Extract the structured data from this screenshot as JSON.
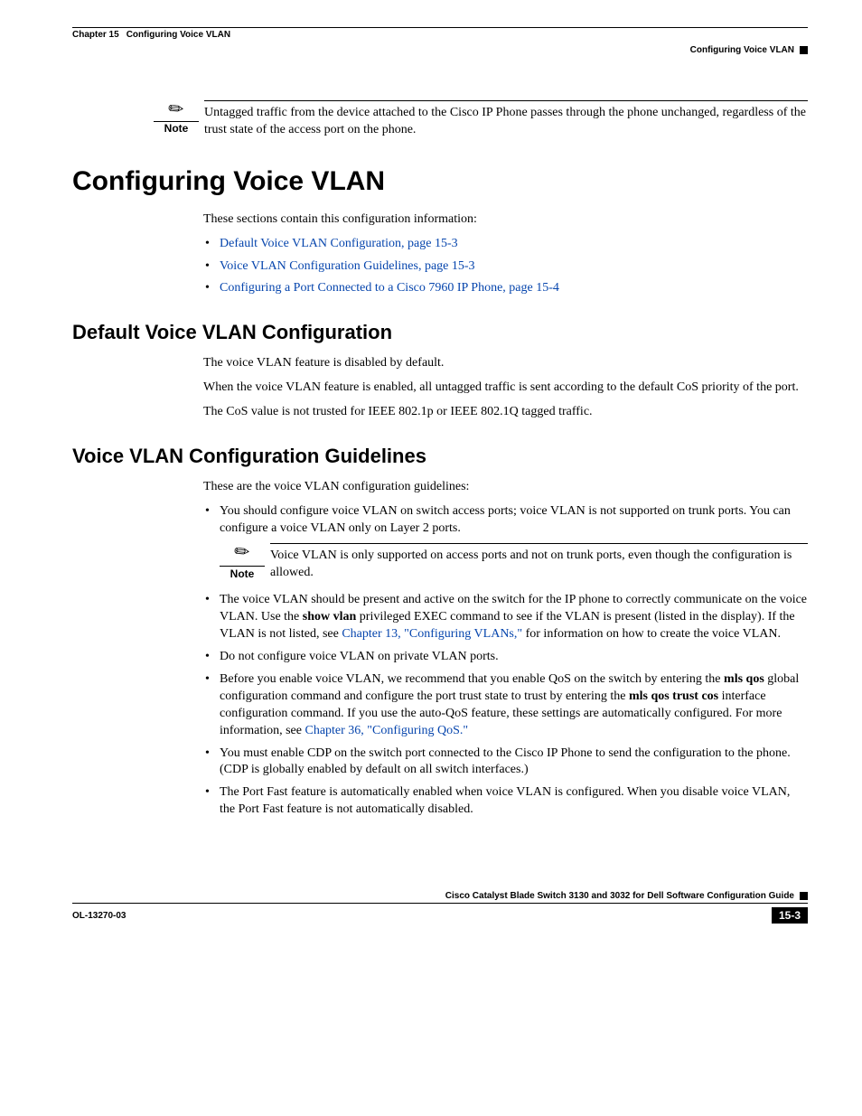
{
  "header": {
    "chapter_label": "Chapter 15",
    "chapter_title": "Configuring Voice VLAN",
    "section_right": "Configuring Voice VLAN"
  },
  "note1": {
    "label": "Note",
    "text": "Untagged traffic from the device attached to the Cisco IP Phone passes through the phone unchanged, regardless of the trust state of the access port on the phone."
  },
  "h1": "Configuring Voice VLAN",
  "intro": "These sections contain this configuration information:",
  "links": [
    "Default Voice VLAN Configuration, page 15-3",
    "Voice VLAN Configuration Guidelines, page 15-3",
    "Configuring a Port Connected to a Cisco 7960 IP Phone, page 15-4"
  ],
  "sec_default": {
    "title": "Default Voice VLAN Configuration",
    "p1": "The voice VLAN feature is disabled by default.",
    "p2": "When the voice VLAN feature is enabled, all untagged traffic is sent according to the default CoS priority of the port.",
    "p3": "The CoS value is not trusted for IEEE 802.1p or IEEE 802.1Q tagged traffic."
  },
  "sec_guidelines": {
    "title": "Voice VLAN Configuration Guidelines",
    "intro": "These are the voice VLAN configuration guidelines:",
    "b1": "You should configure voice VLAN on switch access ports; voice VLAN is not supported on trunk ports. You can configure a voice VLAN only on Layer 2 ports.",
    "note": {
      "label": "Note",
      "text": "Voice VLAN is only supported on access ports and not on trunk ports, even though the configuration is allowed."
    },
    "b2_a": "The voice VLAN should be present and active on the switch for the IP phone to correctly communicate on the voice VLAN. Use the ",
    "b2_bold": "show vlan",
    "b2_b": " privileged EXEC command to see if the VLAN is present (listed in the display). If the VLAN is not listed, see ",
    "b2_link": "Chapter 13, \"Configuring VLANs,\"",
    "b2_c": " for information on how to create the voice VLAN.",
    "b3": "Do not configure voice VLAN on private VLAN ports.",
    "b4_a": "Before you enable voice VLAN, we recommend that you enable QoS on the switch by entering the ",
    "b4_bold1": "mls qos",
    "b4_b": " global configuration command and configure the port trust state to trust by entering the ",
    "b4_bold2": "mls qos trust cos",
    "b4_c": " interface configuration command. If you use the auto-QoS feature, these settings are automatically configured. For more information, see ",
    "b4_link": "Chapter 36, \"Configuring QoS.\"",
    "b5": "You must enable CDP on the switch port connected to the Cisco IP Phone to send the configuration to the phone. (CDP is globally enabled by default on all switch interfaces.)",
    "b6": "The Port Fast feature is automatically enabled when voice VLAN is configured. When you disable voice VLAN, the Port Fast feature is not automatically disabled."
  },
  "footer": {
    "book_title": "Cisco Catalyst Blade Switch 3130 and 3032 for Dell Software Configuration Guide",
    "doc_number": "OL-13270-03",
    "page_number": "15-3"
  }
}
